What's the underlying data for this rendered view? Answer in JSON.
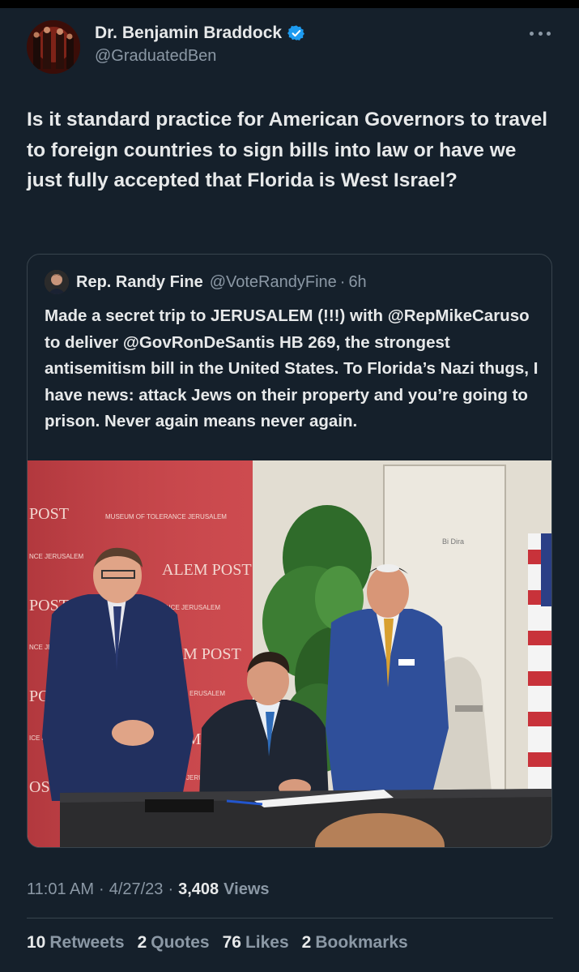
{
  "author": {
    "name": "Dr. Benjamin Braddock",
    "handle": "@GraduatedBen",
    "verified": true
  },
  "tweet_text": "Is it standard practice for American Governors to travel to foreign countries to sign bills into law or have we just fully accepted that Florida is West Israel?",
  "quote": {
    "name": "Rep. Randy Fine",
    "handle": "@VoteRandyFine",
    "separator": "·",
    "time": "6h",
    "text": "Made a secret trip to JERUSALEM (!!!) with @RepMikeCaruso to deliver @GovRonDeSantis HB 269, the strongest antisemitism bill in the United States.   To Florida’s Nazi thugs, I have news: attack Jews on their property and you’re going to prison. Never again means never again.",
    "photo": {
      "signs": [
        "POST",
        "MUSEUM OF TOLERANCE JERUSALEM",
        "NCE JERUSALEM",
        "ALEM POST",
        "POST",
        "LERANCE JERUSALEM",
        "NCE JE",
        "M POST",
        "POST",
        "ERUSALEM",
        "ICE JE",
        "AM PO",
        "OST",
        "JERUS"
      ],
      "door_label": "Bi Dira"
    }
  },
  "meta": {
    "time": "11:01 AM",
    "sep1": "·",
    "date": "4/27/23",
    "sep2": "·",
    "views": "3,408",
    "views_label": "Views"
  },
  "stats": [
    {
      "num": "10",
      "label": "Retweets"
    },
    {
      "num": "2",
      "label": "Quotes"
    },
    {
      "num": "76",
      "label": "Likes"
    },
    {
      "num": "2",
      "label": "Bookmarks"
    }
  ],
  "colors": {
    "background": "#15202b",
    "text": "#e7e9ea",
    "secondary": "#8b98a5",
    "border": "#38444d",
    "verified": "#1d9bf0"
  }
}
